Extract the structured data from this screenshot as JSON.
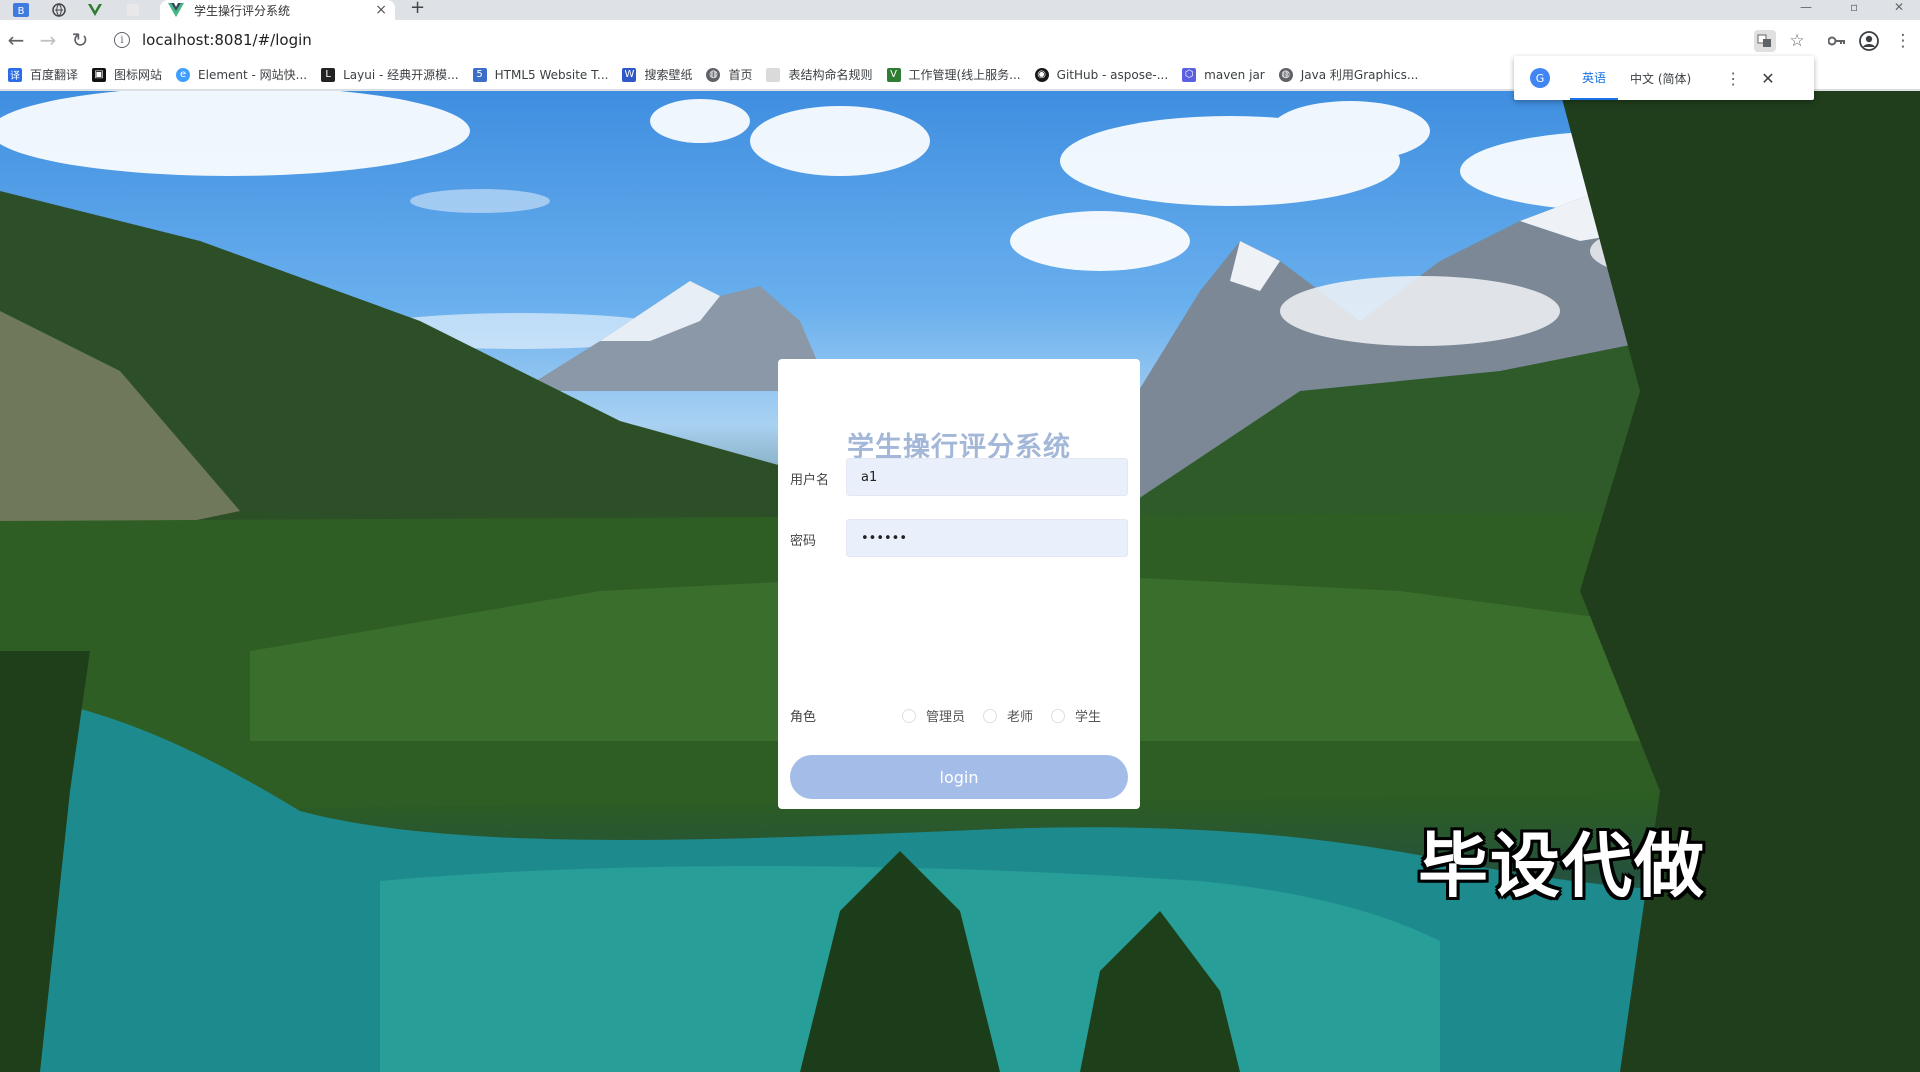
{
  "browser": {
    "tab_title": "学生操行评分系统",
    "tab_close": "×",
    "new_tab": "+",
    "url": "localhost:8081/#/login",
    "bookmarks": [
      {
        "label": "百度翻译",
        "color": "#2b6de8",
        "icon": "baidu-translate-icon"
      },
      {
        "label": "图标网站",
        "color": "#111111",
        "icon": "icon-site-icon"
      },
      {
        "label": "Element - 网站快...",
        "color": "#409eff",
        "icon": "element-icon"
      },
      {
        "label": "Layui - 经典开源模...",
        "color": "#222222",
        "icon": "layui-icon"
      },
      {
        "label": "HTML5 Website T...",
        "color": "#3b6fc7",
        "icon": "html5-icon"
      },
      {
        "label": "搜索壁纸",
        "color": "#2f58c8",
        "icon": "wallpaper-icon"
      },
      {
        "label": "首页",
        "color": "#5f6368",
        "icon": "globe-icon"
      },
      {
        "label": "表结构命名规则",
        "color": "#dadada",
        "icon": "doc-icon"
      },
      {
        "label": "工作管理(线上服务...",
        "color": "#2e7d32",
        "icon": "vue-icon"
      },
      {
        "label": "GitHub - aspose-...",
        "color": "#181717",
        "icon": "github-icon"
      },
      {
        "label": "maven jar",
        "color": "#5a60e0",
        "icon": "maven-icon"
      },
      {
        "label": "Java 利用Graphics...",
        "color": "#5f6368",
        "icon": "globe-icon"
      }
    ]
  },
  "translate_popup": {
    "lang_english": "英语",
    "lang_chinese": "中文 (简体)",
    "more": "⋮",
    "close": "✕"
  },
  "login": {
    "title": "学生操行评分系统",
    "username_label": "用户名",
    "username_value": "a1",
    "password_label": "密码",
    "password_value": "••••••",
    "role_label": "角色",
    "roles": [
      "管理员",
      "老师",
      "学生"
    ],
    "button": "login"
  },
  "watermark": "毕设代做",
  "colors": {
    "title": "#a3b7d9",
    "button": "#a4bde8",
    "input_bg": "#e9f0fb"
  }
}
